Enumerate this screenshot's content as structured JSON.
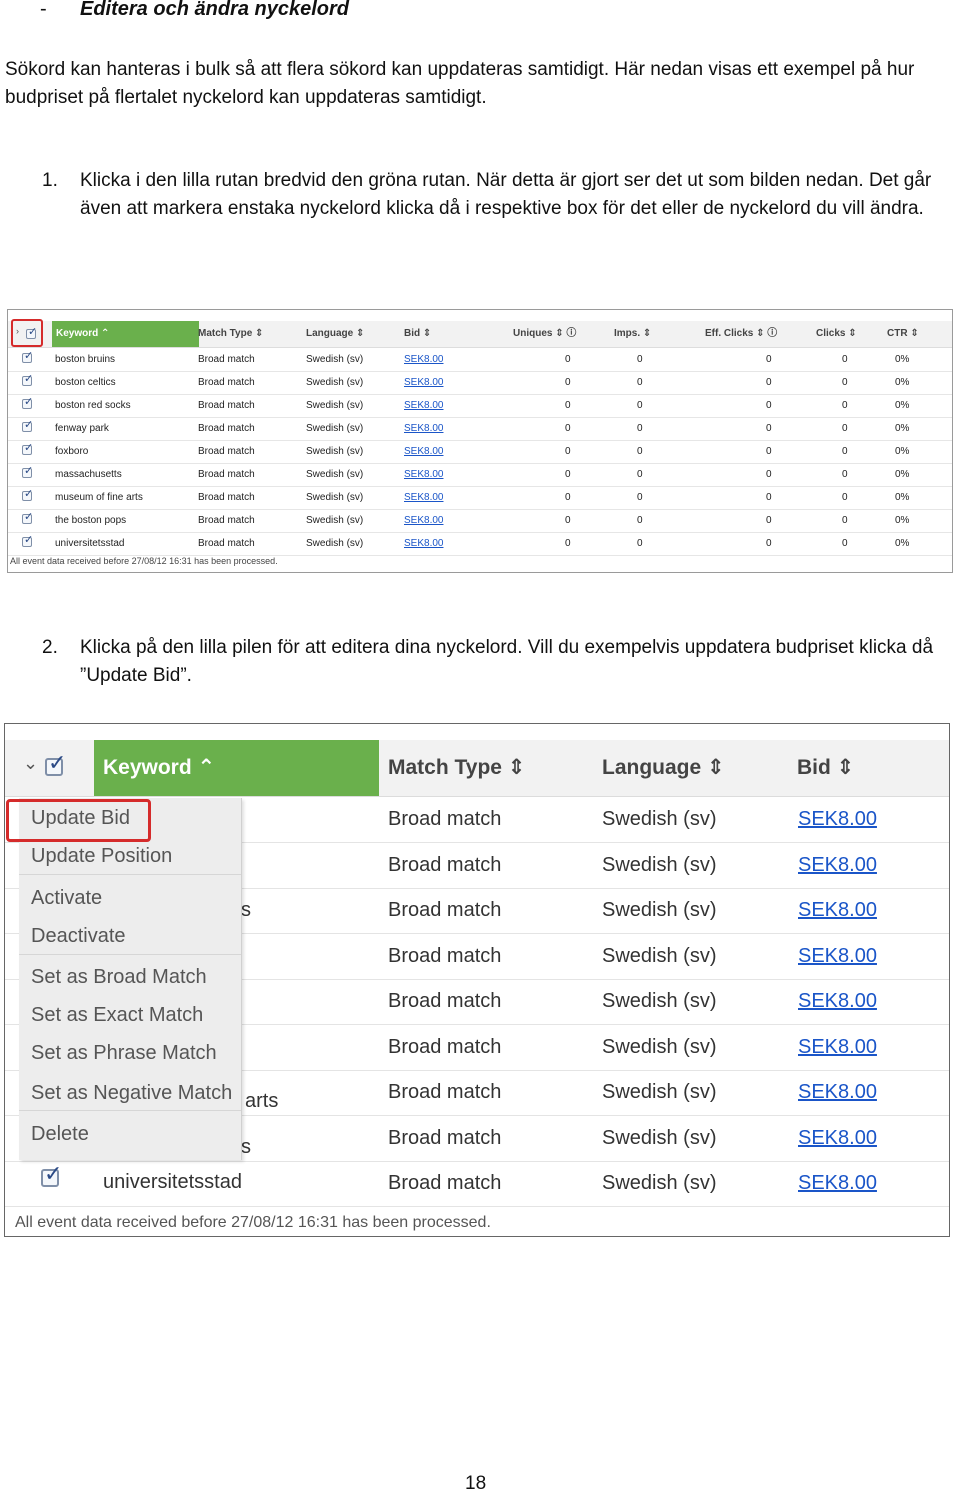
{
  "heading": {
    "dash": "-",
    "text": "Editera och ändra nyckelord"
  },
  "intro": "Sökord kan hanteras i bulk så att flera sökord kan uppdateras samtidigt. Här nedan visas ett exempel på hur budpriset på flertalet nyckelord kan uppdateras samtidigt.",
  "step1": {
    "num": "1.",
    "text": "Klicka i den lilla rutan bredvid den gröna rutan. När detta är gjort ser det ut som bilden nedan. Det går även att markera enstaka nyckelord klicka då i respektive box för det eller de nyckelord du vill ändra."
  },
  "step2": {
    "num": "2.",
    "text": "Klicka på den lilla pilen för att editera dina nyckelord. Vill du exempelvis uppdatera budpriset klicka då ”Update Bid”."
  },
  "shot1": {
    "headers": {
      "keyword": "Keyword ⌃",
      "match_type": "Match Type ⇕",
      "language": "Language ⇕",
      "bid": "Bid ⇕",
      "uniques": "Uniques ⇕ ⓘ",
      "imps": "Imps. ⇕",
      "eff_clicks": "Eff. Clicks ⇕ ⓘ",
      "clicks": "Clicks ⇕",
      "ctr": "CTR ⇕"
    },
    "rows": [
      {
        "keyword": "boston bruins",
        "match": "Broad match",
        "lang": "Swedish (sv)",
        "bid": "SEK8.00",
        "uniques": "0",
        "imps": "0",
        "eff": "0",
        "clicks": "0",
        "ctr": "0%"
      },
      {
        "keyword": "boston celtics",
        "match": "Broad match",
        "lang": "Swedish (sv)",
        "bid": "SEK8.00",
        "uniques": "0",
        "imps": "0",
        "eff": "0",
        "clicks": "0",
        "ctr": "0%"
      },
      {
        "keyword": "boston red socks",
        "match": "Broad match",
        "lang": "Swedish (sv)",
        "bid": "SEK8.00",
        "uniques": "0",
        "imps": "0",
        "eff": "0",
        "clicks": "0",
        "ctr": "0%"
      },
      {
        "keyword": "fenway park",
        "match": "Broad match",
        "lang": "Swedish (sv)",
        "bid": "SEK8.00",
        "uniques": "0",
        "imps": "0",
        "eff": "0",
        "clicks": "0",
        "ctr": "0%"
      },
      {
        "keyword": "foxboro",
        "match": "Broad match",
        "lang": "Swedish (sv)",
        "bid": "SEK8.00",
        "uniques": "0",
        "imps": "0",
        "eff": "0",
        "clicks": "0",
        "ctr": "0%"
      },
      {
        "keyword": "massachusetts",
        "match": "Broad match",
        "lang": "Swedish (sv)",
        "bid": "SEK8.00",
        "uniques": "0",
        "imps": "0",
        "eff": "0",
        "clicks": "0",
        "ctr": "0%"
      },
      {
        "keyword": "museum of fine arts",
        "match": "Broad match",
        "lang": "Swedish (sv)",
        "bid": "SEK8.00",
        "uniques": "0",
        "imps": "0",
        "eff": "0",
        "clicks": "0",
        "ctr": "0%"
      },
      {
        "keyword": "the boston pops",
        "match": "Broad match",
        "lang": "Swedish (sv)",
        "bid": "SEK8.00",
        "uniques": "0",
        "imps": "0",
        "eff": "0",
        "clicks": "0",
        "ctr": "0%"
      },
      {
        "keyword": "universitetsstad",
        "match": "Broad match",
        "lang": "Swedish (sv)",
        "bid": "SEK8.00",
        "uniques": "0",
        "imps": "0",
        "eff": "0",
        "clicks": "0",
        "ctr": "0%"
      }
    ],
    "footer": "All event data received before 27/08/12 16:31 has been processed."
  },
  "shot2": {
    "headers": {
      "keyword": "Keyword ⌃",
      "match_type": "Match Type ⇕",
      "language": "Language ⇕",
      "bid": "Bid ⇕"
    },
    "menu": [
      "Update Bid",
      "Update Position",
      "Activate",
      "Deactivate",
      "Set as Broad Match",
      "Set as Exact Match",
      "Set as Phrase Match",
      "Set as Negative Match",
      "Delete"
    ],
    "partial_keywords": [
      "s",
      "arts",
      "s"
    ],
    "rows": [
      {
        "match": "Broad match",
        "lang": "Swedish (sv)",
        "bid": "SEK8.00"
      },
      {
        "match": "Broad match",
        "lang": "Swedish (sv)",
        "bid": "SEK8.00"
      },
      {
        "match": "Broad match",
        "lang": "Swedish (sv)",
        "bid": "SEK8.00"
      },
      {
        "match": "Broad match",
        "lang": "Swedish (sv)",
        "bid": "SEK8.00"
      },
      {
        "match": "Broad match",
        "lang": "Swedish (sv)",
        "bid": "SEK8.00"
      },
      {
        "match": "Broad match",
        "lang": "Swedish (sv)",
        "bid": "SEK8.00"
      },
      {
        "match": "Broad match",
        "lang": "Swedish (sv)",
        "bid": "SEK8.00"
      },
      {
        "match": "Broad match",
        "lang": "Swedish (sv)",
        "bid": "SEK8.00"
      },
      {
        "match": "Broad match",
        "lang": "Swedish (sv)",
        "bid": "SEK8.00"
      }
    ],
    "last_keyword": "universitetsstad",
    "footer": "All event data received before 27/08/12 16:31 has been processed."
  },
  "page_number": "18",
  "colors": {
    "header_green": "#6ab04c",
    "highlight_red": "#d52b2b",
    "link_blue": "#1a55c8"
  }
}
